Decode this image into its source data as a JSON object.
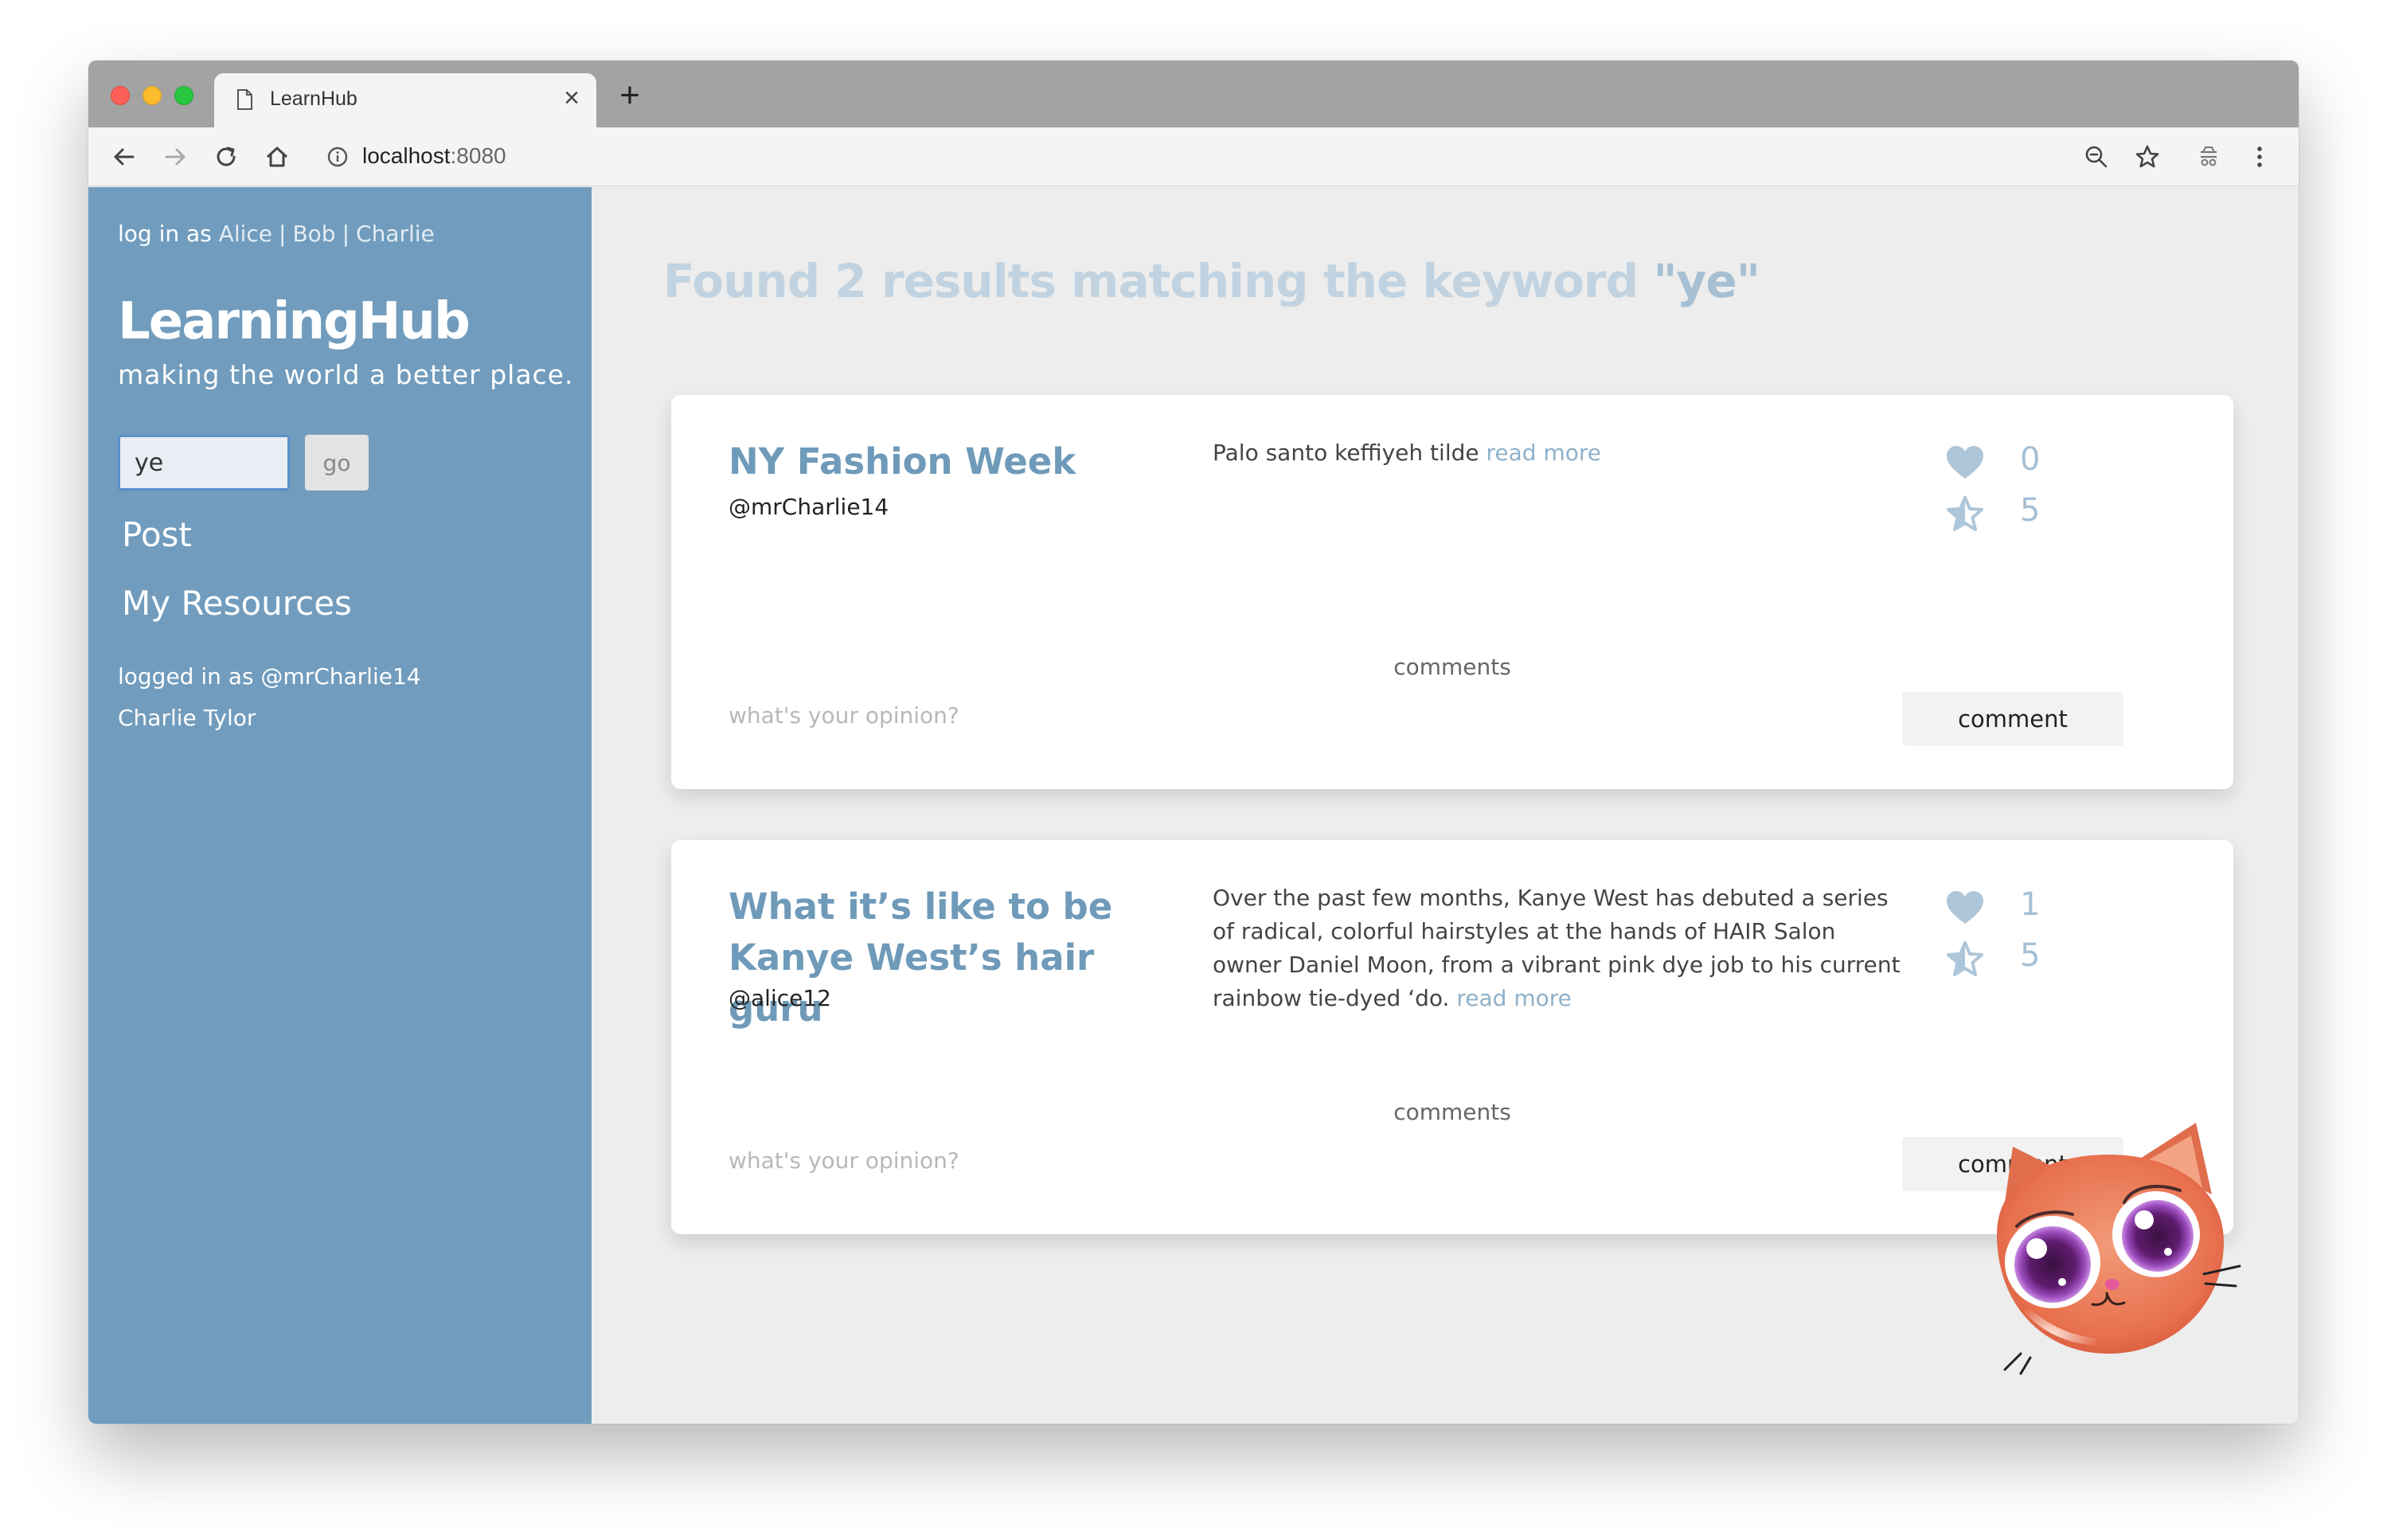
{
  "browser": {
    "tab_title": "LearnHub",
    "url_host": "localhost",
    "url_port": ":8080"
  },
  "sidebar": {
    "login_prefix": "log in as",
    "login_users": [
      "Alice",
      "Bob",
      "Charlie"
    ],
    "login_separator": "|",
    "brand": "LearningHub",
    "tagline": "making the world a better place.",
    "search_value": "ye",
    "go_label": "go",
    "nav": [
      "Post",
      "My Resources"
    ],
    "logged_in_as": "logged in as @mrCharlie14",
    "user_full_name": "Charlie Tylor"
  },
  "main": {
    "heading_prefix": "Found 2 results matching the keyword",
    "heading_keyword": "\"ye\"",
    "cards": [
      {
        "title": "NY Fashion Week",
        "author": "@mrCharlie14",
        "description": "Palo santo keffiyeh tilde",
        "read_more": "read more",
        "likes": "0",
        "rating": "5",
        "comments_label": "comments",
        "opinion_placeholder": "what's your opinion?",
        "comment_button": "comment"
      },
      {
        "title": "What it’s like to be Kanye West’s hair guru",
        "author": "@alice12",
        "description": "Over the past few months, Kanye West has debuted a series of radical, colorful hairstyles at the hands of HAIR Salon owner Daniel Moon, from a vibrant pink dye job to his current rainbow tie-dyed ‘do.",
        "read_more": "read more",
        "likes": "1",
        "rating": "5",
        "comments_label": "comments",
        "opinion_placeholder": "what's your opinion?",
        "comment_button": "comment"
      }
    ]
  },
  "colors": {
    "sidebar_bg": "#719cbd",
    "accent": "#6f9ab9",
    "heading": "#c1d3e1"
  },
  "icons": [
    "document-icon",
    "close-icon",
    "plus-icon",
    "back-icon",
    "forward-icon",
    "reload-icon",
    "home-icon",
    "info-icon",
    "zoom-icon",
    "star-icon",
    "extension-icon",
    "menu-icon",
    "heart-icon",
    "star-rating-icon",
    "cat-mascot"
  ]
}
